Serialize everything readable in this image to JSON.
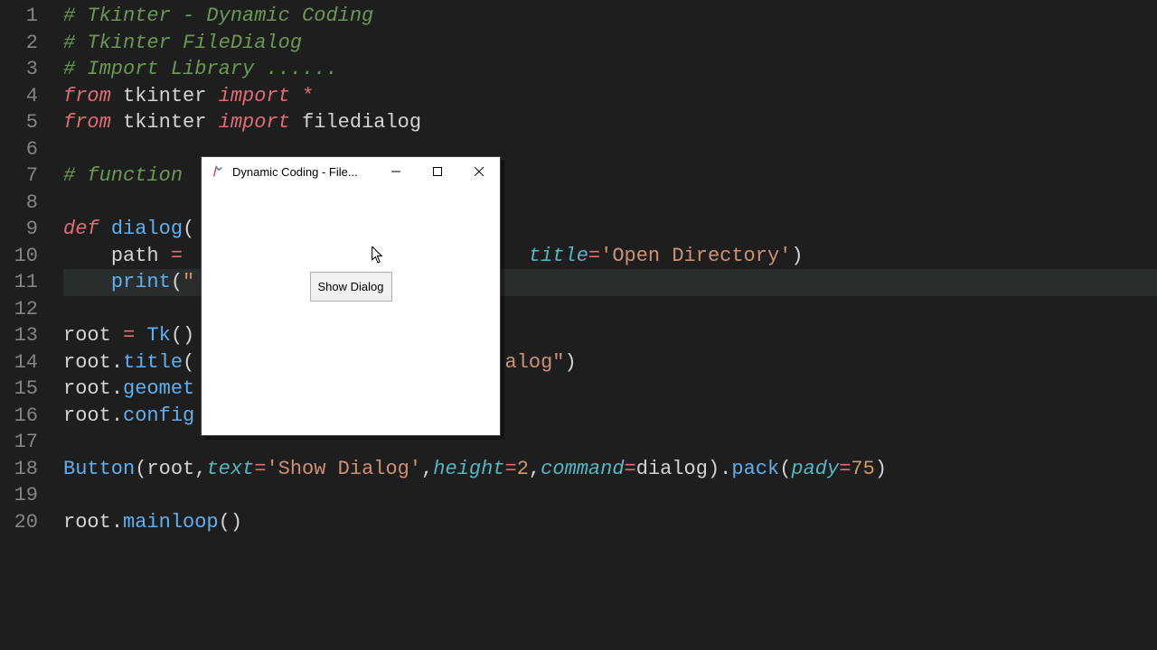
{
  "lines": [
    [
      {
        "t": "# Tkinter - Dynamic Coding",
        "c": "c-comment"
      }
    ],
    [
      {
        "t": "# Tkinter FileDialog",
        "c": "c-comment"
      }
    ],
    [
      {
        "t": "# Import Library ......",
        "c": "c-comment"
      }
    ],
    [
      {
        "t": "from ",
        "c": "c-import"
      },
      {
        "t": "tkinter ",
        "c": "c-ident"
      },
      {
        "t": "import ",
        "c": "c-import"
      },
      {
        "t": "*",
        "c": "c-op"
      }
    ],
    [
      {
        "t": "from ",
        "c": "c-import"
      },
      {
        "t": "tkinter ",
        "c": "c-ident"
      },
      {
        "t": "import ",
        "c": "c-import"
      },
      {
        "t": "filedialog",
        "c": "c-ident"
      }
    ],
    [],
    [
      {
        "t": "# function",
        "c": "c-comment"
      }
    ],
    [],
    [
      {
        "t": "def ",
        "c": "c-keyword"
      },
      {
        "t": "dialog",
        "c": "c-func"
      },
      {
        "t": "(",
        "c": "c-punc"
      }
    ],
    [
      {
        "t": "    ",
        "c": "c-ident"
      },
      {
        "t": "path ",
        "c": "c-ident"
      },
      {
        "t": "= ",
        "c": "c-op"
      },
      {
        "t": "                            ",
        "c": "c-ident"
      },
      {
        "t": "title",
        "c": "c-param"
      },
      {
        "t": "=",
        "c": "c-op"
      },
      {
        "t": "'Open Directory'",
        "c": "c-str"
      },
      {
        "t": ")",
        "c": "c-punc"
      }
    ],
    [
      {
        "t": "    ",
        "c": "c-ident"
      },
      {
        "t": "print",
        "c": "c-func"
      },
      {
        "t": "(",
        "c": "c-punc"
      },
      {
        "t": "\"",
        "c": "c-str"
      }
    ],
    [],
    [
      {
        "t": "root ",
        "c": "c-ident"
      },
      {
        "t": "= ",
        "c": "c-op"
      },
      {
        "t": "Tk",
        "c": "c-func"
      },
      {
        "t": "()",
        "c": "c-punc"
      }
    ],
    [
      {
        "t": "root",
        "c": "c-ident"
      },
      {
        "t": ".",
        "c": "c-punc"
      },
      {
        "t": "title",
        "c": "c-attr"
      },
      {
        "t": "(",
        "c": "c-punc"
      },
      {
        "t": "                          ",
        "c": "c-ident"
      },
      {
        "t": "alog\"",
        "c": "c-str"
      },
      {
        "t": ")",
        "c": "c-punc"
      }
    ],
    [
      {
        "t": "root",
        "c": "c-ident"
      },
      {
        "t": ".",
        "c": "c-punc"
      },
      {
        "t": "geomet",
        "c": "c-attr"
      }
    ],
    [
      {
        "t": "root",
        "c": "c-ident"
      },
      {
        "t": ".",
        "c": "c-punc"
      },
      {
        "t": "config",
        "c": "c-attr"
      }
    ],
    [],
    [
      {
        "t": "Button",
        "c": "c-func"
      },
      {
        "t": "(",
        "c": "c-punc"
      },
      {
        "t": "root",
        "c": "c-ident"
      },
      {
        "t": ",",
        "c": "c-punc"
      },
      {
        "t": "text",
        "c": "c-param"
      },
      {
        "t": "=",
        "c": "c-op"
      },
      {
        "t": "'Show Dialog'",
        "c": "c-str"
      },
      {
        "t": ",",
        "c": "c-punc"
      },
      {
        "t": "height",
        "c": "c-param"
      },
      {
        "t": "=",
        "c": "c-op"
      },
      {
        "t": "2",
        "c": "c-num"
      },
      {
        "t": ",",
        "c": "c-punc"
      },
      {
        "t": "command",
        "c": "c-param"
      },
      {
        "t": "=",
        "c": "c-op"
      },
      {
        "t": "dialog",
        "c": "c-ident"
      },
      {
        "t": ")",
        "c": "c-punc"
      },
      {
        "t": ".",
        "c": "c-punc"
      },
      {
        "t": "pack",
        "c": "c-attr"
      },
      {
        "t": "(",
        "c": "c-punc"
      },
      {
        "t": "pady",
        "c": "c-param"
      },
      {
        "t": "=",
        "c": "c-op"
      },
      {
        "t": "75",
        "c": "c-num"
      },
      {
        "t": ")",
        "c": "c-punc"
      }
    ],
    [],
    [
      {
        "t": "root",
        "c": "c-ident"
      },
      {
        "t": ".",
        "c": "c-punc"
      },
      {
        "t": "mainloop",
        "c": "c-attr"
      },
      {
        "t": "()",
        "c": "c-punc"
      }
    ]
  ],
  "window": {
    "title": "Dynamic Coding - File...",
    "button_label": "Show Dialog"
  }
}
